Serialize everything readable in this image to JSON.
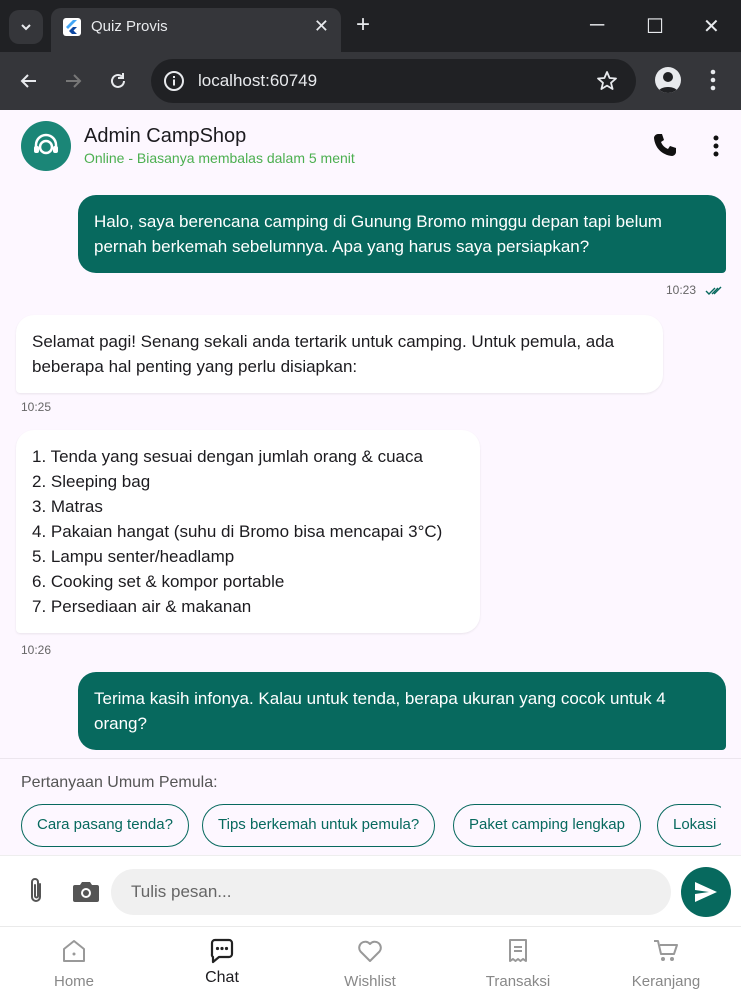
{
  "browser": {
    "tab_title": "Quiz Provis",
    "tab_close": "✕",
    "new_tab": "+",
    "url": "localhost:60749",
    "minimize": "─",
    "maximize": "☐",
    "close": "✕"
  },
  "header": {
    "name": "Admin CampShop",
    "status": "Online - Biasanya membalas dalam 5 menit"
  },
  "messages": [
    {
      "side": "out",
      "text": "Halo, saya berencana camping di Gunung Bromo minggu depan tapi belum\npernah berkemah sebelumnya. Apa yang harus saya persiapkan?",
      "time": "10:23"
    },
    {
      "side": "in",
      "text": "Selamat pagi! Senang sekali anda tertarik untuk camping. Untuk pemula, ada\nbeberapa hal penting yang perlu disiapkan:",
      "time": "10:25"
    },
    {
      "side": "in",
      "text": "1. Tenda yang sesuai dengan jumlah orang & cuaca\n2. Sleeping bag\n3. Matras\n4. Pakaian hangat (suhu di Bromo bisa mencapai 3°C)\n5. Lampu senter/headlamp\n6. Cooking set & kompor portable\n7. Persediaan air & makanan",
      "time": "10:26"
    },
    {
      "side": "out",
      "text": "Terima kasih infonya. Kalau untuk tenda, berapa ukuran yang cocok untuk 4\norang?",
      "time": ""
    }
  ],
  "quick": {
    "title": "Pertanyaan Umum Pemula:",
    "chips": [
      "Cara pasang tenda?",
      "Tips berkemah untuk pemula?",
      "Paket camping lengkap",
      "Lokasi"
    ]
  },
  "composer": {
    "placeholder": "Tulis pesan..."
  },
  "nav": {
    "items": [
      {
        "label": "Home",
        "icon": "home-icon"
      },
      {
        "label": "Chat",
        "icon": "chat-icon"
      },
      {
        "label": "Wishlist",
        "icon": "heart-icon"
      },
      {
        "label": "Transaksi",
        "icon": "receipt-icon"
      },
      {
        "label": "Keranjang",
        "icon": "cart-icon"
      }
    ],
    "active": "Chat"
  },
  "colors": {
    "accent": "#07695e",
    "online": "#4caf50",
    "background": "#fdf7ff"
  }
}
